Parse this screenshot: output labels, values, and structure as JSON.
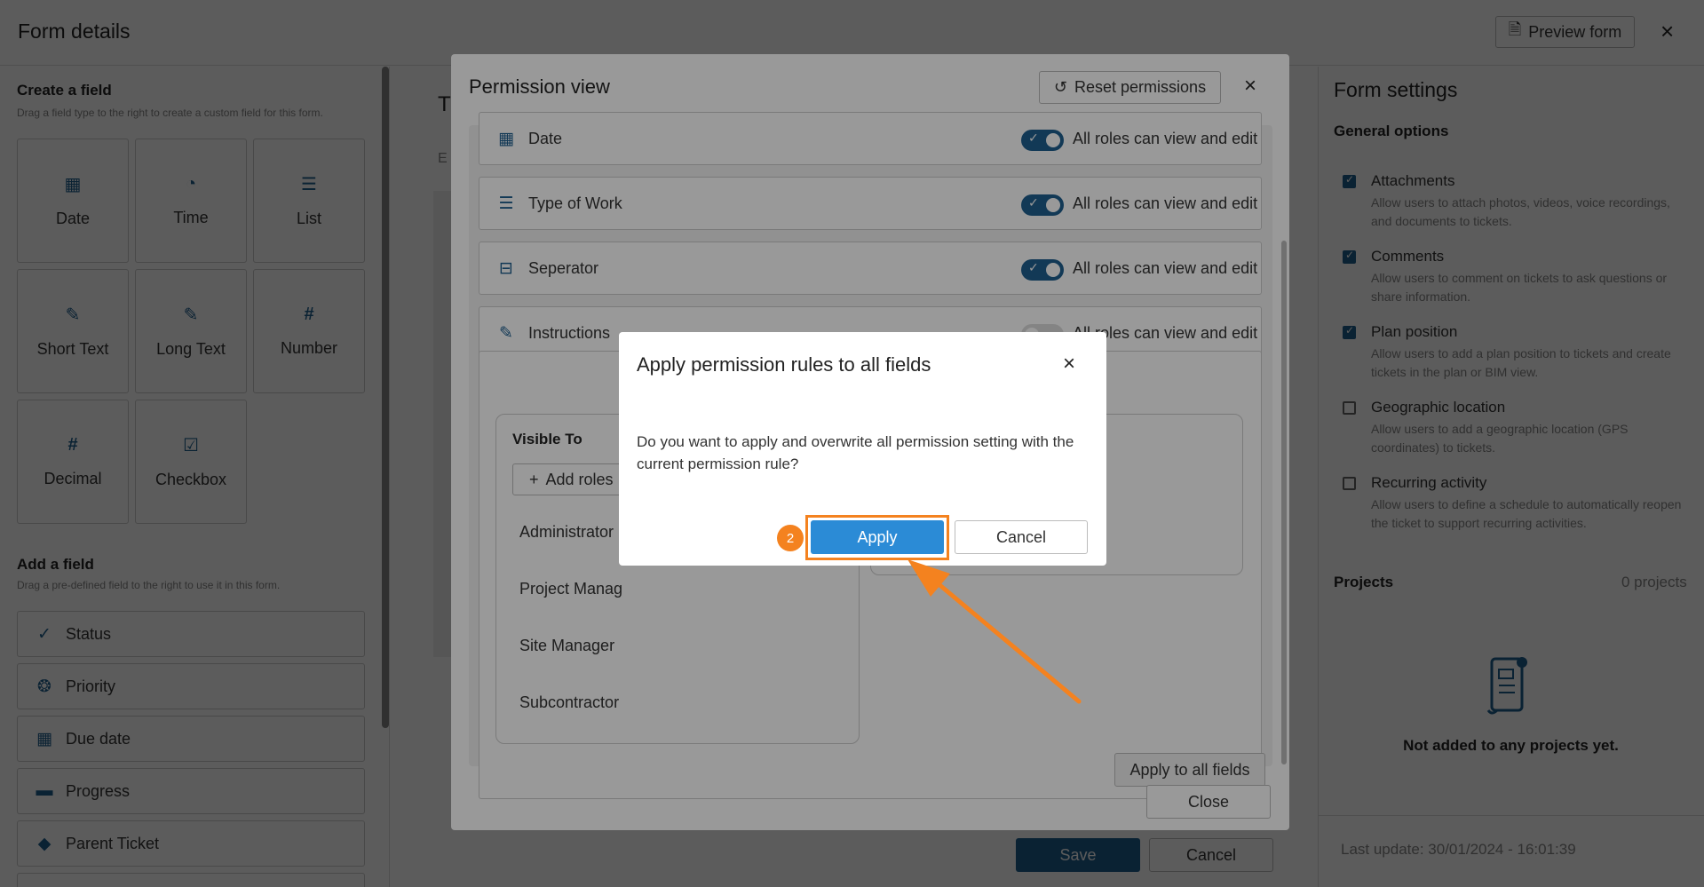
{
  "header": {
    "title": "Form details",
    "preview_label": "Preview form",
    "close_icon": "×"
  },
  "create_field": {
    "title": "Create a field",
    "subtitle": "Drag a field type to the right to create a custom field for this form.",
    "tiles": [
      {
        "label": "Date",
        "icon": "calendar-icon",
        "glyph": "▦"
      },
      {
        "label": "Time",
        "icon": "clock-icon",
        "glyph": "◔"
      },
      {
        "label": "List",
        "icon": "list-icon",
        "glyph": "☰"
      },
      {
        "label": "Short Text",
        "icon": "edit-icon",
        "glyph": "✎"
      },
      {
        "label": "Long Text",
        "icon": "edit-icon",
        "glyph": "✎"
      },
      {
        "label": "Number",
        "icon": "hash-icon",
        "glyph": "#"
      },
      {
        "label": "Decimal",
        "icon": "hash-icon",
        "glyph": "#"
      },
      {
        "label": "Checkbox",
        "icon": "checkbox-icon",
        "glyph": "☑"
      }
    ]
  },
  "add_field": {
    "title": "Add a field",
    "subtitle": "Drag a pre-defined field to the right to use it in this form.",
    "fields": [
      {
        "label": "Status",
        "icon": "check-icon",
        "glyph": "✓"
      },
      {
        "label": "Priority",
        "icon": "medal-icon",
        "glyph": "❂"
      },
      {
        "label": "Due date",
        "icon": "calendar-icon",
        "glyph": "▦"
      },
      {
        "label": "Progress",
        "icon": "progress-icon",
        "glyph": "▬"
      },
      {
        "label": "Parent Ticket",
        "icon": "tags-icon",
        "glyph": "◆"
      }
    ]
  },
  "middle": {
    "title_fragment": "T",
    "text_fragment": "E",
    "save_label": "Save",
    "cancel_label": "Cancel"
  },
  "form_settings": {
    "title": "Form settings",
    "general_title": "General options",
    "options": [
      {
        "name": "Attachments",
        "desc": "Allow users to attach photos, videos, voice recordings, and documents to tickets.",
        "checked": true
      },
      {
        "name": "Comments",
        "desc": "Allow users to comment on tickets to ask questions or share information.",
        "checked": true
      },
      {
        "name": "Plan position",
        "desc": "Allow users to add a plan position to tickets and create tickets in the plan or BIM view.",
        "checked": true
      },
      {
        "name": "Geographic location",
        "desc": "Allow users to add a geographic location (GPS coordinates) to tickets.",
        "checked": false
      },
      {
        "name": "Recurring activity",
        "desc": "Allow users to define a schedule to automatically reopen the ticket to support recurring activities.",
        "checked": false
      }
    ],
    "projects_title": "Projects",
    "projects_count": "0 projects",
    "projects_empty": "Not added to any projects yet.",
    "last_update": "Last update: 30/01/2024 - 16:01:39"
  },
  "permission_view": {
    "title": "Permission view",
    "reset_label": "Reset permissions",
    "rows": [
      {
        "name": "Date",
        "icon": "calendar-icon",
        "glyph": "▦",
        "toggle_on": true,
        "toggle_label": "All roles can view and edit"
      },
      {
        "name": "Type of Work",
        "icon": "list-icon",
        "glyph": "☰",
        "toggle_on": true,
        "toggle_label": "All roles can view and edit"
      },
      {
        "name": "Seperator",
        "icon": "separator-icon",
        "glyph": "⊟",
        "toggle_on": true,
        "toggle_label": "All roles can view and edit"
      },
      {
        "name": "Instructions",
        "icon": "edit-icon",
        "glyph": "✎",
        "toggle_on": false,
        "toggle_label": "All roles can view and edit"
      }
    ],
    "visible_to": "Visible To",
    "add_roles": "Add roles",
    "roles": [
      "Administrator",
      "Project Manag",
      "Site Manager",
      "Subcontractor"
    ],
    "apply_all_label": "Apply to all fields",
    "close_label": "Close"
  },
  "confirm_dialog": {
    "title": "Apply permission rules to all fields",
    "message": "Do you want to apply and overwrite all permission setting with the current permission rule?",
    "apply_label": "Apply",
    "cancel_label": "Cancel",
    "step_number": "2",
    "highlight_color": "#f4821f"
  }
}
